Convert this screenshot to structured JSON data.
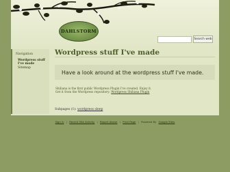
{
  "header": {
    "logo_text": "DAHLSTORM"
  },
  "search": {
    "placeholder": "",
    "button_label": "Search web"
  },
  "sidebar": {
    "heading": "Navigation",
    "items": [
      {
        "label": "Wordpress stuff I've made"
      },
      {
        "label": "Sitemap"
      }
    ]
  },
  "main": {
    "title": "Wordpress stuff I've made",
    "intro": "Have a look around at the wordpress stuff I've made.",
    "para_line1": "Shiliana is the first public Wordpress Plugin I've created. Enjoy it.",
    "para_line2_text": "Get it from the Wordpress repository: ",
    "para_link": "Wordpress Shiliana Plugin",
    "subpages_label": "Subpages (1):",
    "subpages_link": "wordpress sleep"
  },
  "footer": {
    "links": [
      "Sign in",
      "Recent Site Activity",
      "Report Abuse",
      "Print Page",
      "Powered By",
      "Google Sites"
    ],
    "separator": "|"
  },
  "colors": {
    "background": "#8c9c63",
    "header": "#e9ecd3",
    "content": "#e1e6c7",
    "title": "#4f5d2c"
  }
}
